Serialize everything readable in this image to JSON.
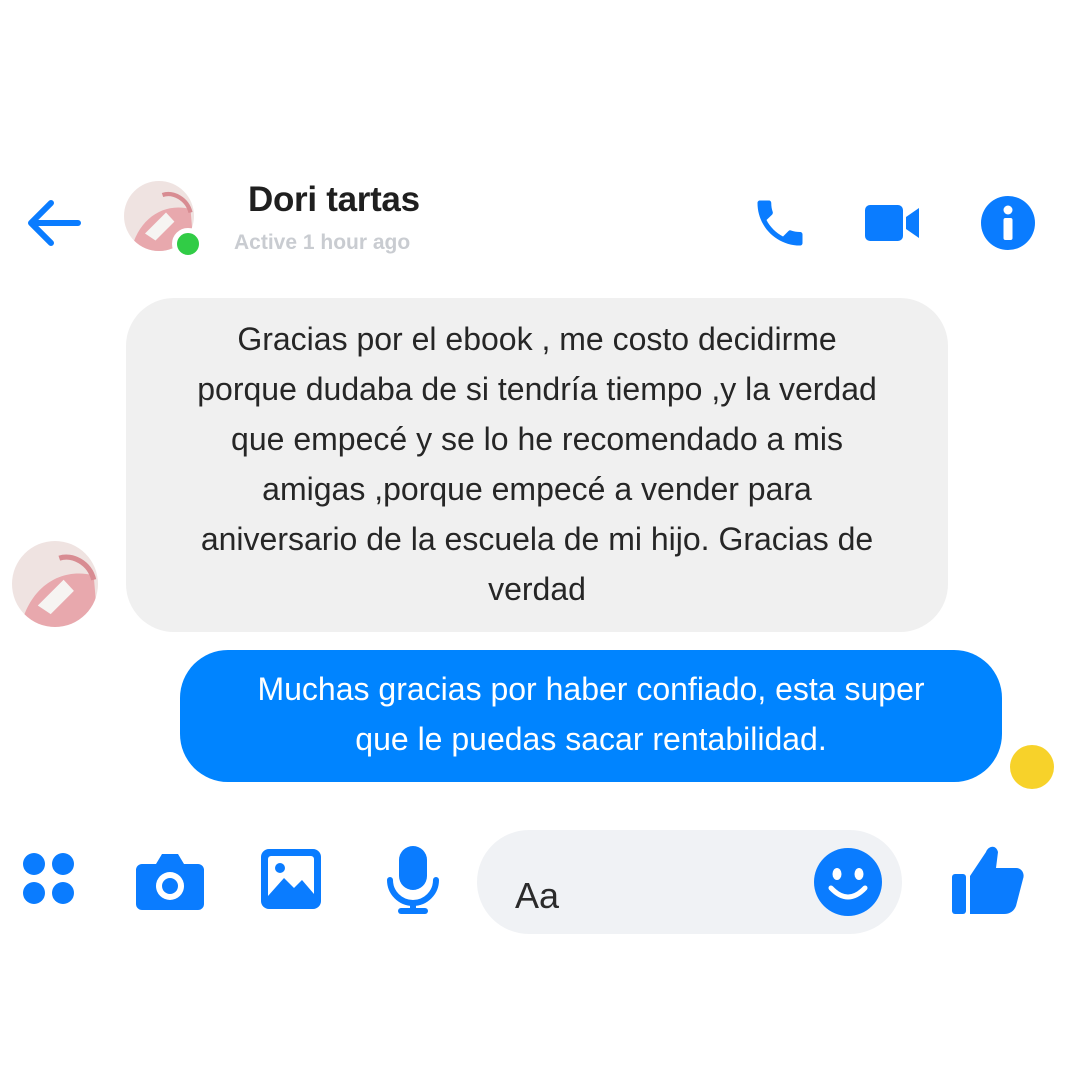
{
  "header": {
    "contact_name": "Dori tartas",
    "status": "Active 1 hour ago",
    "icons": [
      "back-arrow-icon",
      "phone-icon",
      "video-camera-icon",
      "info-icon"
    ]
  },
  "messages": [
    {
      "direction": "incoming",
      "lines": [
        "Gracias por el ebook , me costo decidirme",
        "porque dudaba de si tendría tiempo ,y la verdad",
        "que empecé y se lo he recomendado a mis",
        "amigas ,porque empecé a vender para",
        "aniversario de la escuela de mi hijo. Gracias de",
        "verdad"
      ]
    },
    {
      "direction": "outgoing",
      "lines": [
        "Muchas gracias por haber confiado, esta super",
        "que le puedas sacar rentabilidad."
      ]
    }
  ],
  "composer": {
    "placeholder": "Aa",
    "icons": [
      "apps-grid-icon",
      "camera-icon",
      "image-icon",
      "microphone-icon",
      "emoji-icon",
      "thumbs-up-icon"
    ]
  },
  "colors": {
    "accent": "#0084ff",
    "icon_blue": "#0a7cff",
    "online": "#31cc46",
    "incoming_bubble": "#f0f0f0",
    "input_bg": "#f0f2f5",
    "status_text": "#c9ccd1"
  }
}
